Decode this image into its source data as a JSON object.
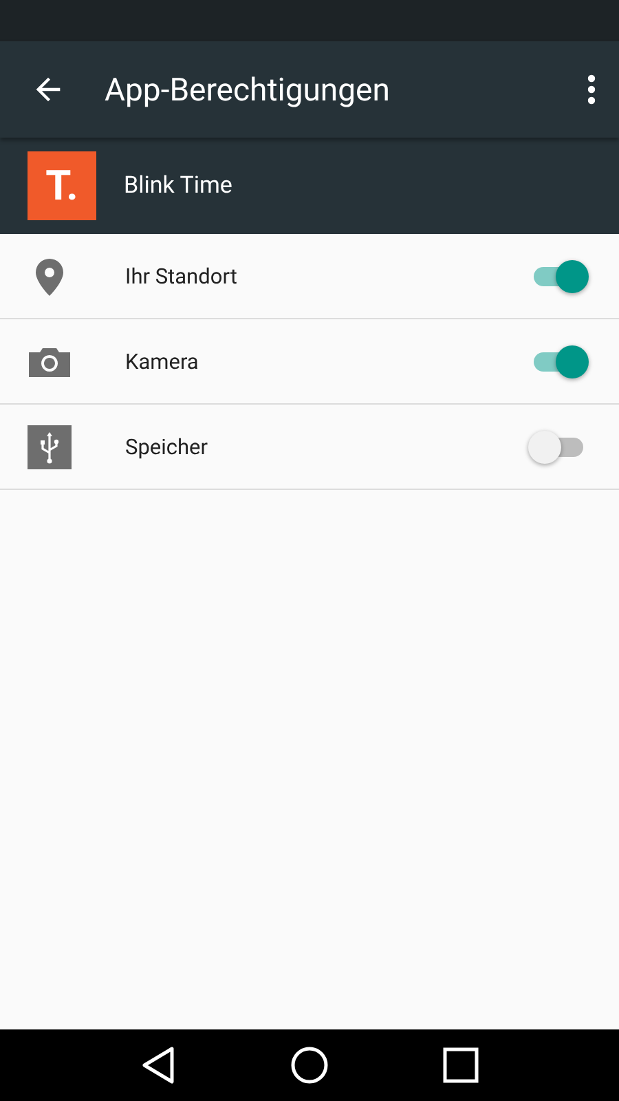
{
  "toolbar": {
    "title": "App-Berechtigungen"
  },
  "app": {
    "icon_text": "T.",
    "name": "Blink Time"
  },
  "permissions": [
    {
      "kind": "location",
      "label": "Ihr Standort",
      "on": true
    },
    {
      "kind": "camera",
      "label": "Kamera",
      "on": true
    },
    {
      "kind": "storage",
      "label": "Speicher",
      "on": false
    }
  ]
}
